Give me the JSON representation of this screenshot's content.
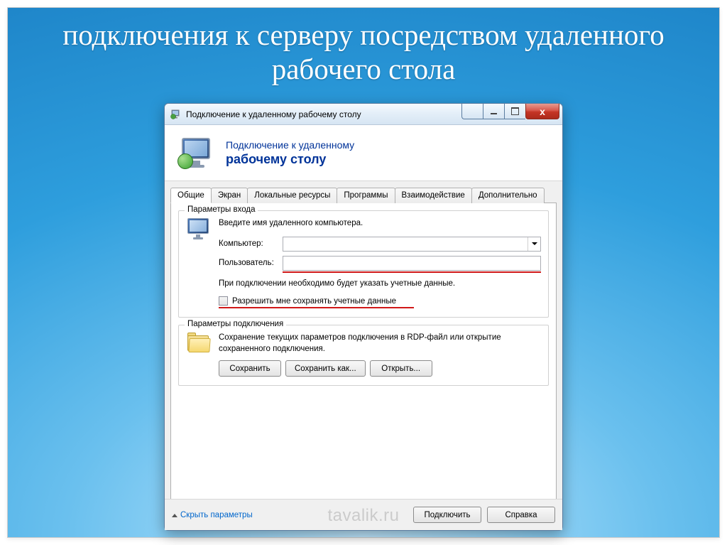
{
  "slide": {
    "title": "подключения к серверу посредством удаленного рабочего стола"
  },
  "window": {
    "title": "Подключение к удаленному рабочему столу",
    "header_line1": "Подключение к удаленному",
    "header_line2": "рабочему столу"
  },
  "tabs": [
    {
      "label": "Общие",
      "active": true
    },
    {
      "label": "Экран"
    },
    {
      "label": "Локальные ресурсы"
    },
    {
      "label": "Программы"
    },
    {
      "label": "Взаимодействие"
    },
    {
      "label": "Дополнительно"
    }
  ],
  "login_group": {
    "title": "Параметры входа",
    "intro": "Введите имя удаленного компьютера.",
    "computer_label": "Компьютер:",
    "computer_value": "",
    "user_label": "Пользователь:",
    "user_value": "",
    "note": "При подключении необходимо будет указать учетные данные.",
    "save_creds_label": "Разрешить мне сохранять учетные данные"
  },
  "conn_group": {
    "title": "Параметры подключения",
    "text": "Сохранение текущих параметров подключения в RDP-файл или открытие сохраненного подключения.",
    "save": "Сохранить",
    "save_as": "Сохранить как...",
    "open": "Открыть..."
  },
  "footer": {
    "hide": "Скрыть параметры",
    "connect": "Подключить",
    "help": "Справка"
  },
  "watermark": "tavalik.ru"
}
